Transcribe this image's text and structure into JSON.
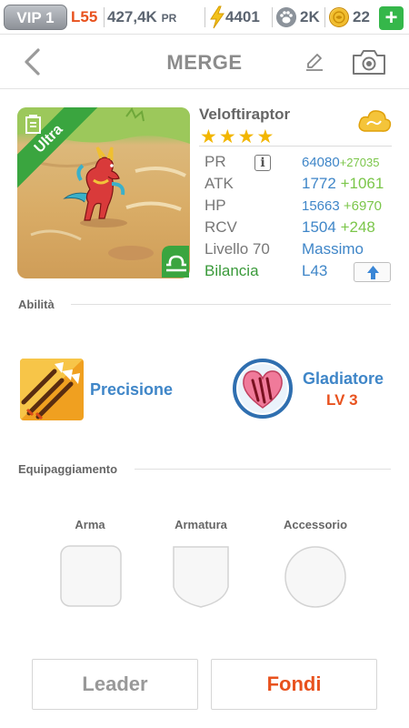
{
  "status_bar": {
    "vip": "VIP 1",
    "level": "L55",
    "power_value": "427,4K",
    "power_unit": "PR",
    "energy": "4401",
    "friends": "2K",
    "coins": "22",
    "plus": "+"
  },
  "header": {
    "title": "MERGE",
    "icons": [
      "back-arrow-icon",
      "pencil-icon",
      "camera-icon"
    ]
  },
  "monster": {
    "name": "Veloftiraptor",
    "rarity": "Ultra",
    "stars": "★★★★",
    "star_count": 4,
    "element_icon": "wind-cloud-icon",
    "stats": [
      {
        "label": "PR",
        "value": "64080",
        "bonus": "+27035"
      },
      {
        "label": "ATK",
        "value": "1772",
        "bonus": "+1061"
      },
      {
        "label": "HP",
        "value": "15663",
        "bonus": "+6970"
      },
      {
        "label": "RCV",
        "value": "1504",
        "bonus": "+248"
      }
    ],
    "level_label": "Livello 70",
    "level_value": "Massimo",
    "balance_label": "Bilancia",
    "balance_value": "L43",
    "info_glyph": "i"
  },
  "abilities": {
    "section_label": "Abilità",
    "skill_name": "Precisione",
    "ability_name": "Gladiatore",
    "ability_level": "LV 3"
  },
  "equipment": {
    "section_label": "Equipaggiamento",
    "slots": [
      "Arma",
      "Armatura",
      "Accessorio"
    ]
  },
  "actions": {
    "leader": "Leader",
    "fuse": "Fondi"
  },
  "colors": {
    "accent_blue": "#3f86c8",
    "accent_orange": "#e8521e",
    "bonus_green": "#7bc64a",
    "star_gold": "#f2b600",
    "plus_green": "#35b74a"
  }
}
